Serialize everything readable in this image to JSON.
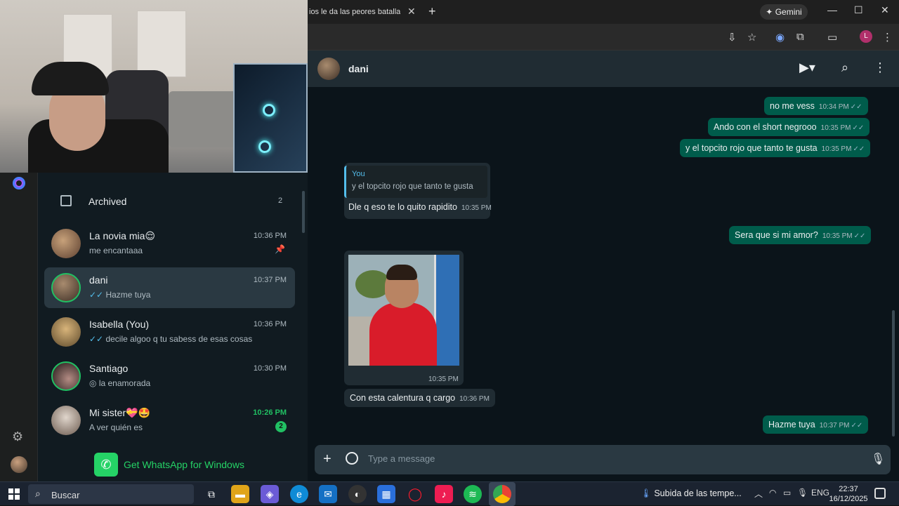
{
  "browser": {
    "tab_title": "ios le da las peores batallas a",
    "tab_close": "✕",
    "new_tab": "+",
    "gemini_label": "Gemini",
    "profile_letter": "L",
    "win_min": "—",
    "win_max": "☐",
    "win_close": "✕"
  },
  "sidebar": {
    "archived_label": "Archived",
    "archived_count": "2",
    "get_whatsapp": "Get WhatsApp for Windows",
    "chats": [
      {
        "name": "La novia mia😌",
        "time": "10:36 PM",
        "last": "me encantaaa",
        "pinned": true
      },
      {
        "name": "dani",
        "time": "10:37 PM",
        "last": "Hazme tuya",
        "ticks": "✓✓"
      },
      {
        "name": "Isabella (You)",
        "time": "10:36 PM",
        "last": "decile algoo q tu sabess de esas cosas",
        "ticks": "✓✓"
      },
      {
        "name": "Santiago",
        "time": "10:30 PM",
        "last": "la enamorada",
        "prefix": "◎"
      },
      {
        "name": "Mi sister💝🤩",
        "time": "10:26 PM",
        "last": "A ver quién es",
        "unread": "2"
      }
    ]
  },
  "chat": {
    "contact_name": "dani",
    "composer_placeholder": "Type a message",
    "messages": [
      {
        "text": "no me vess",
        "time": "10:34 PM",
        "dir": "out"
      },
      {
        "text": "Ando con el short negrooo",
        "time": "10:35 PM",
        "dir": "out"
      },
      {
        "text": "y el topcito rojo que tanto te gusta",
        "time": "10:35 PM",
        "dir": "out"
      },
      {
        "quote_author": "You",
        "quote_text": "y el topcito rojo que tanto te gusta",
        "text": "Dle q eso te lo quito rapidito",
        "time": "10:35 PM",
        "dir": "in"
      },
      {
        "text": "Sera que si mi amor?",
        "time": "10:35 PM",
        "dir": "out"
      },
      {
        "image": "photo-of-boy-in-red-shirt",
        "time": "10:35 PM",
        "dir": "in"
      },
      {
        "text": "Con esta calentura q cargo",
        "time": "10:36 PM",
        "dir": "in"
      },
      {
        "text": "Hazme tuya",
        "time": "10:37 PM",
        "dir": "out"
      }
    ]
  },
  "taskbar": {
    "search_placeholder": "Buscar",
    "weather_text": "Subida de las tempe...",
    "language": "ENG",
    "time": "22:37",
    "date": "16/12/2025"
  },
  "colors": {
    "wa_green": "#21c063",
    "bubble_out": "#005c4b",
    "bubble_in": "#202c33",
    "panel_bg": "#0b141a"
  }
}
